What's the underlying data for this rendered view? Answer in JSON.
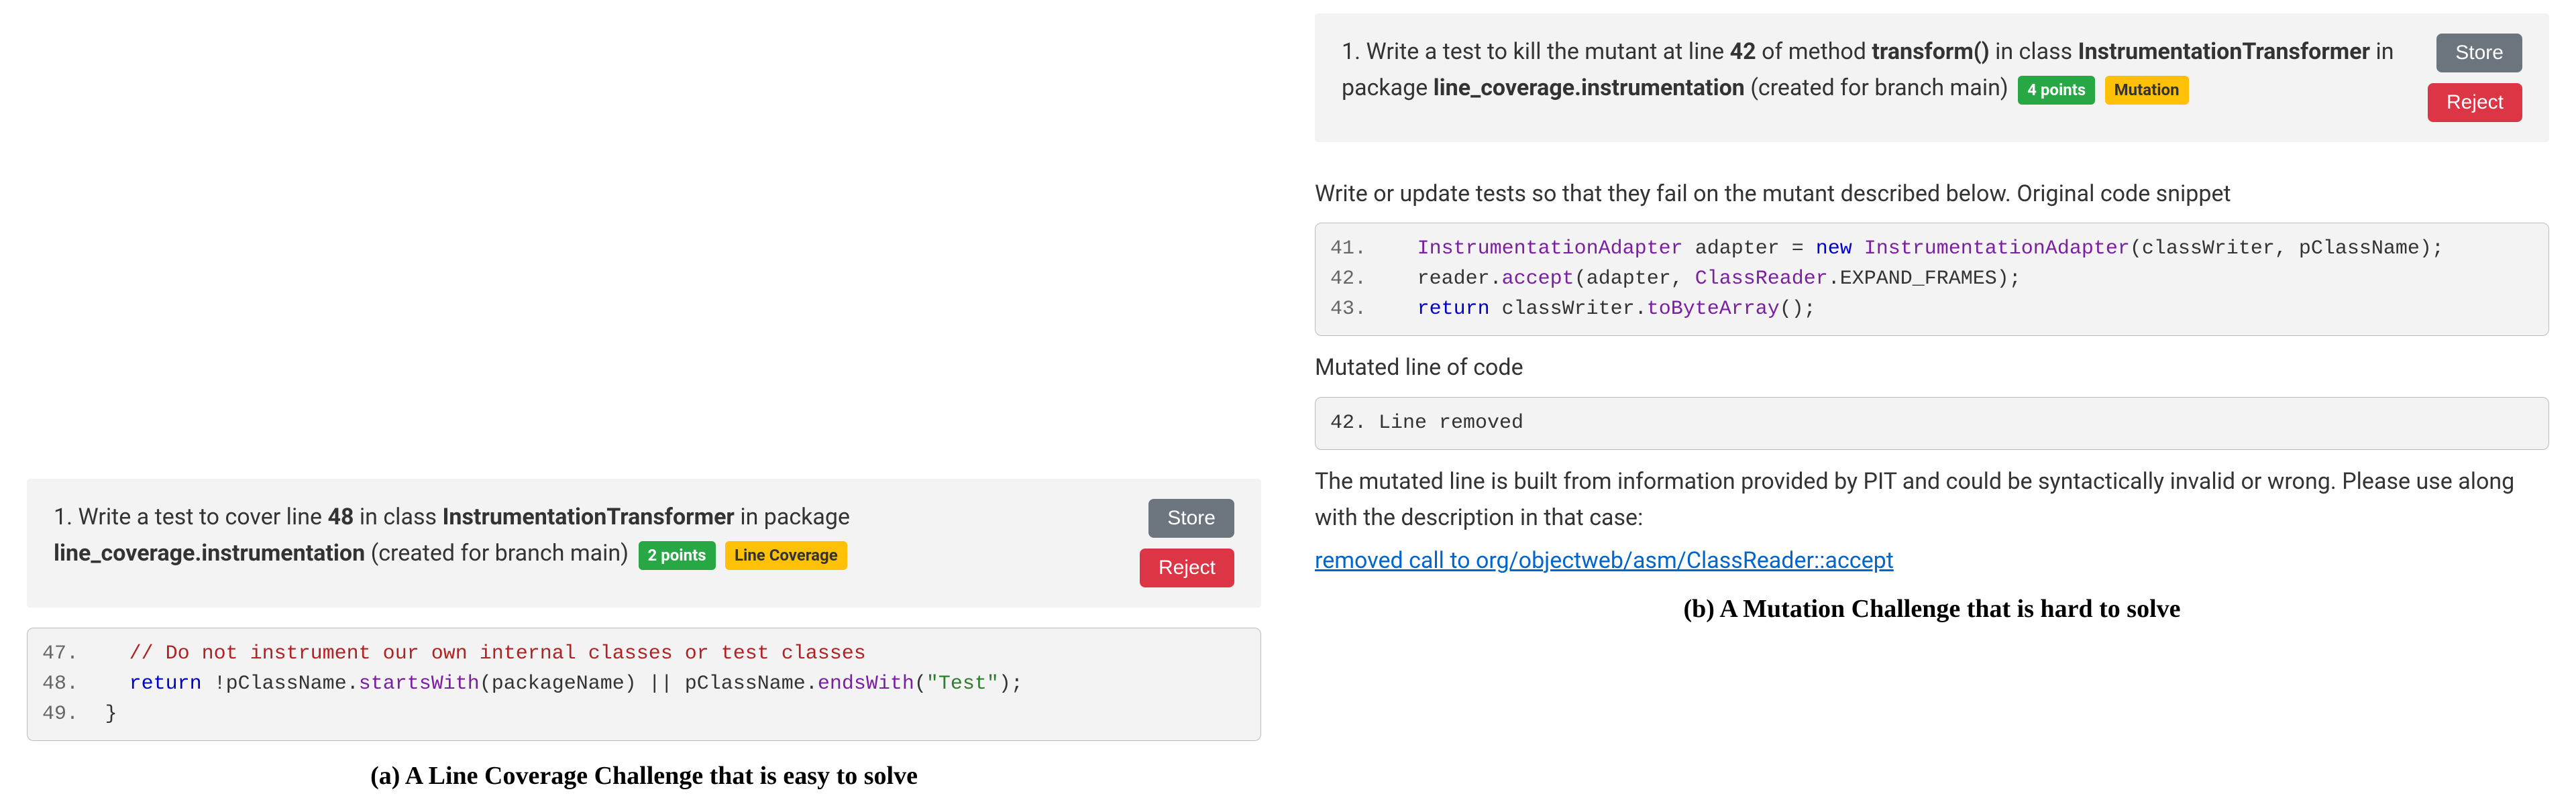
{
  "panelA": {
    "prompt_prefix": "1. Write a test to cover line ",
    "line_num": "48",
    "prompt_mid1": " in class ",
    "class_name": "InstrumentationTransformer",
    "prompt_mid2": " in package ",
    "package_name": "line_coverage.instrumentation",
    "prompt_suffix": " (created for branch main)",
    "badge_points": "2 points",
    "badge_type": "Line Coverage",
    "btn_store": "Store",
    "btn_reject": "Reject",
    "code": {
      "l47_ln": "47.",
      "l47_cmt": "// Do not instrument our own internal classes or test classes",
      "l48_ln": "48.",
      "l48_kw": "return",
      "l48_rest_a": " !pClassName.",
      "l48_m1": "startsWith",
      "l48_p1": "(packageName) || pClassName.",
      "l48_m2": "endsWith",
      "l48_p2": "(",
      "l48_str": "\"Test\"",
      "l48_end": ");",
      "l49_ln": "49.",
      "l49_brace": "}"
    },
    "caption": "(a) A Line Coverage Challenge that is easy to solve"
  },
  "panelB": {
    "prompt_prefix": "1. Write a test to kill the mutant at line ",
    "line_num": "42",
    "prompt_mid1": " of method ",
    "method_name": "transform()",
    "prompt_mid2": " in class ",
    "class_name": "InstrumentationTransformer",
    "prompt_mid3": " in package ",
    "package_name": "line_coverage.instrumentation",
    "prompt_suffix": " (created for branch main)",
    "badge_points": "4 points",
    "badge_type": "Mutation",
    "btn_store": "Store",
    "btn_reject": "Reject",
    "desc1": "Write or update tests so that they fail on the mutant described below. Original code snippet",
    "code": {
      "l41_ln": "41.",
      "l41_type": "InstrumentationAdapter",
      "l41_var": " adapter = ",
      "l41_kw": "new",
      "l41_type2": " InstrumentationAdapter",
      "l41_args": "(classWriter, pClassName);",
      "l42_ln": "42.",
      "l42_a": "reader.",
      "l42_m": "accept",
      "l42_b": "(adapter, ",
      "l42_cls": "ClassReader",
      "l42_c": ".EXPAND_FRAMES);",
      "l43_ln": "43.",
      "l43_kw": "return",
      "l43_a": " classWriter.",
      "l43_m": "toByteArray",
      "l43_end": "();"
    },
    "mutated_label": "Mutated line of code",
    "mutated_line": "42. Line removed",
    "desc2": "The mutated line is built from information provided by PIT and could be syntactically invalid or wrong. Please use along with the description in that case:",
    "link_text": "removed call to org/objectweb/asm/ClassReader::accept",
    "caption": "(b) A Mutation Challenge that is hard to solve"
  }
}
